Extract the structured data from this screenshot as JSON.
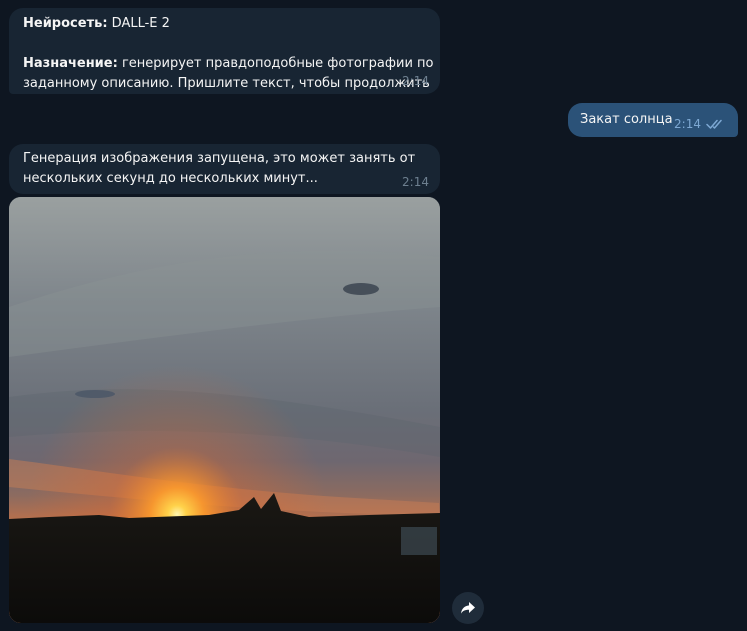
{
  "messages": {
    "bot_intro": {
      "network_label": "Нейросеть:",
      "network_value": " DALL-E 2",
      "purpose_label": "Назначение:",
      "purpose_text_1": " генерирует правдоподобные фотографии по",
      "purpose_text_2": "заданному описанию. Пришлите текст, чтобы продолжить",
      "time": "2:14"
    },
    "user_prompt": {
      "text": "Закат солнца",
      "time": "2:14",
      "status_icon": "double-check-icon"
    },
    "bot_status": {
      "line_1": "Генерация изображения запущена, это может занять от",
      "line_2": "нескольких секунд до нескольких минут...",
      "time": "2:14"
    }
  },
  "generated_photo": {
    "subject": "sunset over field"
  },
  "forward_button": {
    "icon": "forward-arrow-icon"
  },
  "colors": {
    "background": "#0e1621",
    "incoming_bubble": "#182533",
    "outgoing_bubble": "#2b5278",
    "timestamp": "#6d7f8f",
    "read_check": "#7da8d3"
  }
}
